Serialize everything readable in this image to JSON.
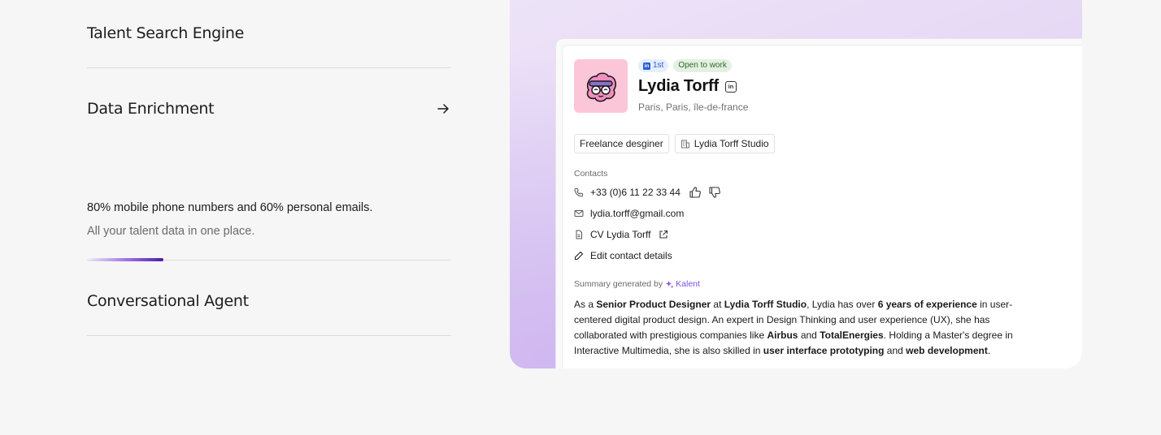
{
  "features": {
    "talent_search": "Talent Search Engine",
    "data_enrichment": "Data Enrichment",
    "desc_primary": "80% mobile phone numbers and 60% personal emails.",
    "desc_secondary": "All your talent data in one place.",
    "progress": 0.21,
    "conversational_agent": "Conversational Agent"
  },
  "profile": {
    "linkedin_degree": "1st",
    "open_badge": "Open to work",
    "name": "Lydia Torff",
    "location": "Paris, Paris, île-de-france",
    "tags": [
      "Freelance desginer",
      "Lydia Torff Studio"
    ],
    "contacts_label": "Contacts",
    "phone": "+33 (0)6 11 22 33 44",
    "email": "lydia.torff@gmail.com",
    "cv": "CV Lydia Torff",
    "edit": "Edit contact details",
    "summary_label": "Summary generated by",
    "summary_brand": "Kalent",
    "summary": {
      "p1": "As a ",
      "b1": "Senior Product Designer",
      "p2": " at ",
      "b2": "Lydia Torff Studio",
      "p3": ", Lydia has over ",
      "b3": "6 years of experience",
      "p4": " in user-centered digital product design. An expert in Design Thinking and user experience (UX), she has collaborated with prestigious companies like ",
      "b4": "Airbus",
      "p5": " and ",
      "b5": "TotalEnergies",
      "p6": ". Holding a Master's degree in Interactive Multimedia, she is also skilled in ",
      "b6": "user interface prototyping",
      "p7": " and ",
      "b7": "web development",
      "p8": "."
    }
  },
  "colors": {
    "accent": "#7c4dde",
    "linkedin": "#2a5bd7",
    "open_green": "#2f6b2c",
    "avatar_bg": "#fcc6d9"
  }
}
